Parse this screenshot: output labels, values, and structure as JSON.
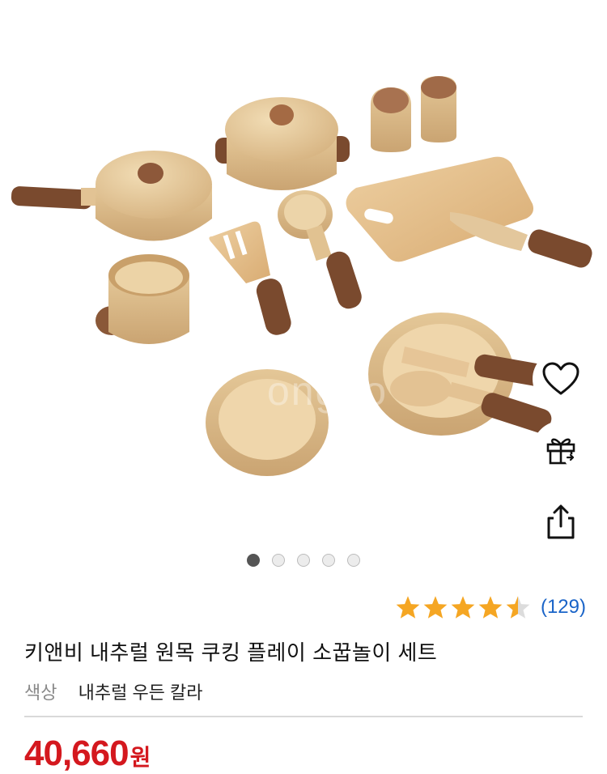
{
  "gallery": {
    "image_alt": "wooden cooking play set",
    "dots": [
      true,
      false,
      false,
      false,
      false
    ]
  },
  "actions": {
    "wishlist_icon": "heart-icon",
    "gift_icon": "gift-icon",
    "share_icon": "share-icon"
  },
  "product": {
    "rating": 4.5,
    "review_count": "(129)",
    "title": "키앤비 내추럴 원목 쿠킹 플레이 소꿉놀이 세트",
    "option_label": "색상",
    "option_value": "내추럴 우든 칼라",
    "price": "40,660",
    "price_unit": "원"
  },
  "colors": {
    "star": "#f5a623",
    "review_link": "#1a64c8",
    "price": "#d4181e",
    "wood_light": "#e6cda3",
    "wood_dark": "#7a4a2e"
  }
}
